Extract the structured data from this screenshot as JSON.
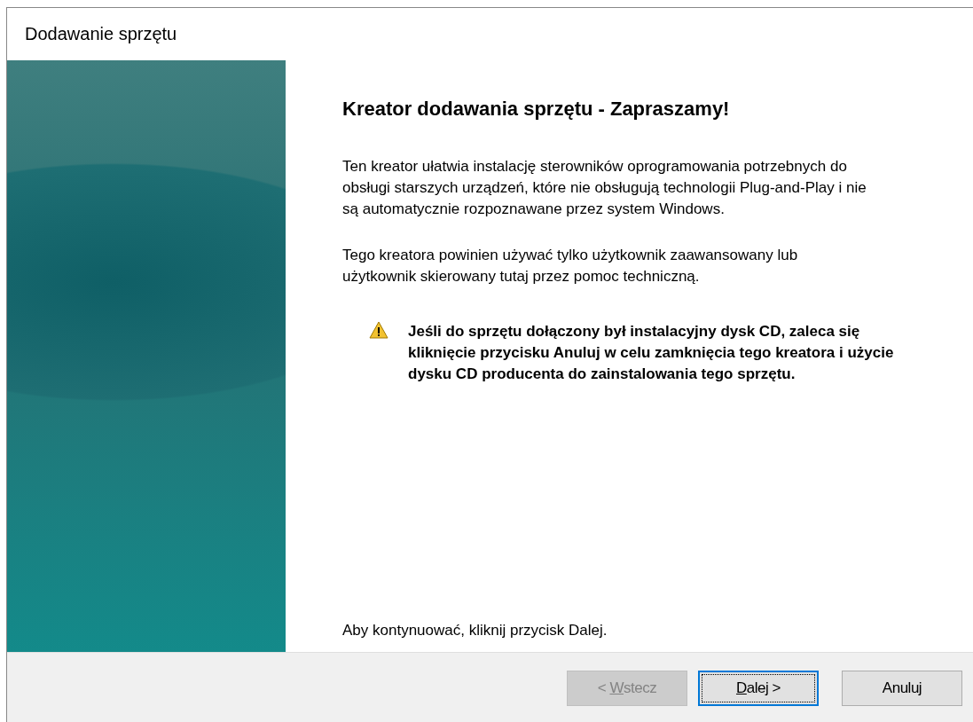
{
  "window": {
    "title": "Dodawanie sprzętu"
  },
  "wizard": {
    "heading": "Kreator dodawania sprzętu - Zapraszamy!",
    "paragraphs": [
      "Ten kreator ułatwia instalację sterowników oprogramowania potrzebnych do obsługi starszych urządzeń, które nie obsługują technologii Plug-and-Play i nie są automatycznie rozpoznawane przez system Windows.",
      "Tego kreatora powinien używać tylko użytkownik zaawansowany lub użytkownik skierowany tutaj przez pomoc techniczną."
    ],
    "warning": "Jeśli do sprzętu dołączony był instalacyjny dysk CD, zaleca się kliknięcie przycisku Anuluj w celu zamknięcia tego kreatora i użycie dysku CD producenta do zainstalowania tego sprzętu.",
    "footer_text": "Aby kontynuować, kliknij przycisk Dalej."
  },
  "buttons": [
    {
      "before": "< ",
      "access_key": "W",
      "after": "stecz",
      "disabled": true,
      "default": false
    },
    {
      "access_key": "D",
      "after": "alej >",
      "disabled": false,
      "default": true
    },
    {
      "before": "Anuluj",
      "disabled": false,
      "default": false
    }
  ]
}
